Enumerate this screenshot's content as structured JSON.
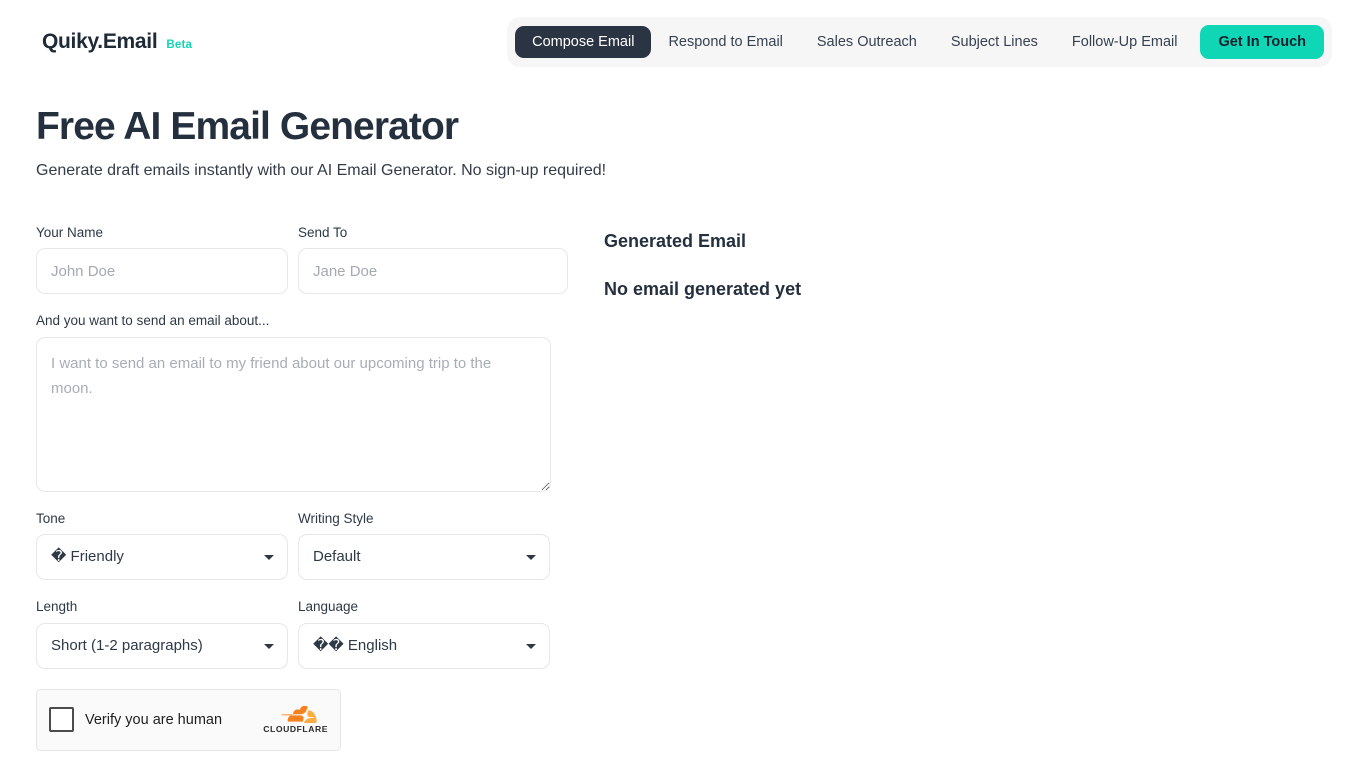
{
  "header": {
    "brand_name": "Quiky.Email",
    "brand_badge": "Beta",
    "nav_items": [
      {
        "label": "Compose Email",
        "active": true
      },
      {
        "label": "Respond to Email",
        "active": false
      },
      {
        "label": "Sales Outreach",
        "active": false
      },
      {
        "label": "Subject Lines",
        "active": false
      },
      {
        "label": "Follow-Up Email",
        "active": false
      }
    ],
    "cta_label": "Get In Touch",
    "accent_color": "#0fd6b4",
    "active_pill_color": "#2b3443"
  },
  "main": {
    "title": "Free AI Email Generator",
    "subtitle": "Generate draft emails instantly with our AI Email Generator. No sign-up required!"
  },
  "form": {
    "your_name": {
      "label": "Your Name",
      "value": "",
      "placeholder": "John Doe"
    },
    "send_to": {
      "label": "Send To",
      "value": "",
      "placeholder": "Jane Doe"
    },
    "about": {
      "label": "And you want to send an email about...",
      "value": "",
      "placeholder": "I want to send an email to my friend about our upcoming trip to the moon."
    },
    "tone": {
      "label": "Tone",
      "selected": "� Friendly",
      "options": [
        "� Friendly"
      ]
    },
    "writing_style": {
      "label": "Writing Style",
      "selected": "Default",
      "options": [
        "Default"
      ]
    },
    "length": {
      "label": "Length",
      "selected": "Short (1-2 paragraphs)",
      "options": [
        "Short (1-2 paragraphs)"
      ]
    },
    "language": {
      "label": "Language",
      "selected": "�� English",
      "options": [
        "�� English"
      ]
    }
  },
  "turnstile": {
    "label": "Verify you are human",
    "checked": false,
    "brand": "CLOUDFLARE",
    "brand_color": "#f6821f"
  },
  "result": {
    "title": "Generated Email",
    "empty_message": "No email generated yet"
  }
}
